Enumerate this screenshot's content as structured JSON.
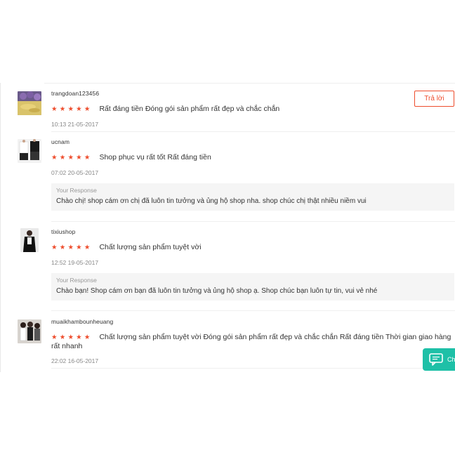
{
  "reviews": [
    {
      "username": "trangdoan123456",
      "stars": [
        "★",
        "★",
        "★",
        "★",
        "★"
      ],
      "rating": 5,
      "comment": "Rất đáng tiền Đóng gói sản phẩm rất đẹp và chắc chắn",
      "timestamp": "10:13 21-05-2017",
      "avatar": "flower-photo"
    },
    {
      "username": "ucnam",
      "stars": [
        "★",
        "★",
        "★",
        "★",
        "★"
      ],
      "rating": 5,
      "comment": "Shop phục vụ rất tốt Rất đáng tiền",
      "timestamp": "07:02 20-05-2017",
      "avatar": "clothing-photo",
      "response": {
        "label": "Your Response",
        "text": "Chào chị! shop cám ơn chị đã luôn tin tưởng và ủng hộ shop nha. shop chúc chị thật nhiều niềm vui"
      }
    },
    {
      "username": "tixiushop",
      "stars": [
        "★",
        "★",
        "★",
        "★",
        "★"
      ],
      "rating": 5,
      "comment": "Chất lượng sản phẩm tuyệt vời",
      "timestamp": "12:52 19-05-2017",
      "avatar": "person-photo",
      "response": {
        "label": "Your Response",
        "text": "Chào bạn! Shop cám ơn bạn đã luôn tin tưởng và ủng hộ shop ạ. Shop chúc bạn luôn tự tin, vui vẻ nhé"
      }
    },
    {
      "username": "muaikhambounheuang",
      "stars": [
        "★",
        "★",
        "★",
        "★",
        "★"
      ],
      "rating": 5,
      "comment": "Chất lượng sản phẩm tuyệt vời Đóng gói sản phẩm rất đẹp và chắc chắn Rất đáng tiền Thời gian giao hàng rất nhanh",
      "timestamp": "22:02 16-05-2017",
      "avatar": "group-photo"
    }
  ],
  "reply_button": {
    "label": "Trả lời"
  },
  "chat_button": {
    "label": "Ch",
    "icon": "chat-bubble-icon"
  },
  "colors": {
    "accent": "#ee4d2d",
    "chat": "#1ec0a7",
    "response_bg": "#f5f5f5"
  }
}
